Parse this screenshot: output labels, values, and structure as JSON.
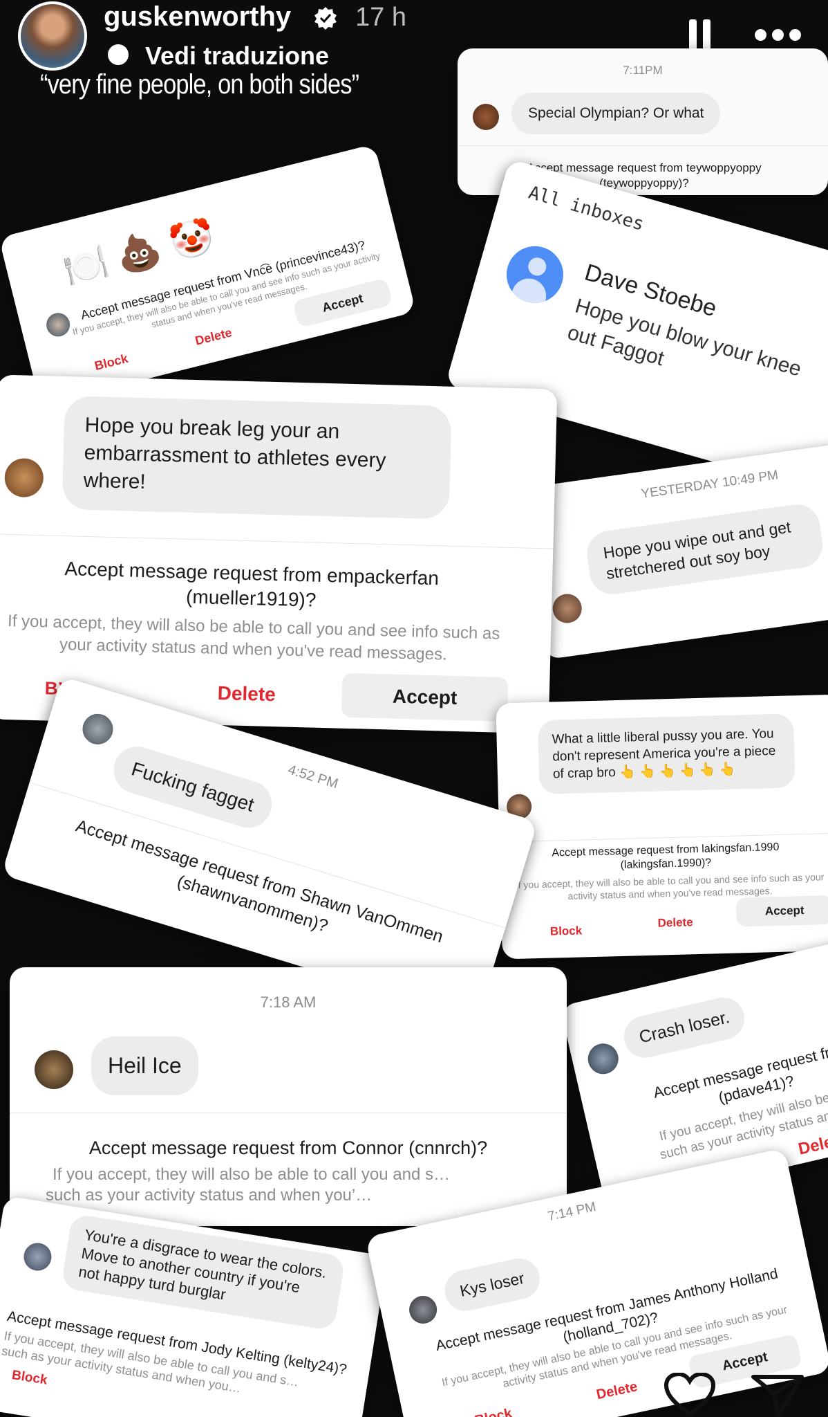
{
  "story": {
    "username": "guskenworthy",
    "time_ago": "17 h",
    "translate_label": "Vedi traduzione",
    "caption": "“very fine people, on both sides”"
  },
  "cards": {
    "teywoppy": {
      "time": "7:11PM",
      "message": "Special Olympian? Or what",
      "request": "Accept message request from teywoppyoppy (teywoppyoppy)?"
    },
    "vince": {
      "emojis": "🍽️ 💩 🤡",
      "request": "Accept message request from Vnc͡e (princevince43)?",
      "info": "If you accept, they will also be able to call you and see info such as your activity status and when you've read messages.",
      "accept": "Accept",
      "delete": "Delete",
      "block": "Block"
    },
    "dave": {
      "header": "All inboxes",
      "name": "Dave Stoebe",
      "message": "Hope you blow your knee out Faggot"
    },
    "mueller": {
      "message": "Hope you break leg your an embarrassment to athletes every where!",
      "request_line1": "Accept message request from empackerfan",
      "request_line2": "(mueller1919)?",
      "info": "If you accept, they will also be able to call you and see info such as your activity status and when you've read messages.",
      "block": "Bʼ",
      "delete": "Delete",
      "accept": "Accept"
    },
    "soyboy": {
      "time": "YESTERDAY 10:49 PM",
      "message": "Hope you wipe out and get stretchered out soy boy"
    },
    "shawn": {
      "time": "4:52 PM",
      "message": "Fucking fagget",
      "request_line1": "Accept message request from Shawn VanOmmen",
      "request_line2": "(shawnvanommen)?"
    },
    "lakings": {
      "message": "What a little liberal pussy you are. You don't represent America you're a piece of crap bro 👆 👆 👆 👆 👆 👆",
      "request_line1": "Accept message request from lakingsfan.1990",
      "request_line2": "(lakingsfan.1990)?",
      "info": "If you accept, they will also be able to call you and see info such as your activity status and when you've read messages.",
      "block": "Block",
      "delete": "Delete",
      "accept": "Accept"
    },
    "connor": {
      "time": "7:18 AM",
      "message": "Heil Ice",
      "request": "Accept message request from Connor (cnnrch)?",
      "info_line1": "If you accept, they will also be able to call you and s…",
      "info_line2": "such as your activity status and when you’…"
    },
    "pdave": {
      "message": "Crash loser.",
      "request_line1": "Accept message request from",
      "request_line2": "(pdave41)?",
      "info_line1": "If you accept, they will also be able",
      "info_line2": "such as your activity status and whe",
      "delete": "Delete"
    },
    "kelty": {
      "message": "You're a disgrace to wear the colors. Move to another country if you're not happy turd burglar",
      "request": "Accept message request from Jody Kelting (kelty24)?",
      "info_line1": "If you accept, they will also be able to call you and s…",
      "info_line2": "such as your activity status and when you…",
      "block": "Block"
    },
    "holland": {
      "time": "7:14 PM",
      "message": "Kys loser",
      "request_line1": "Accept message request from James Anthony Holland",
      "request_line2": "(holland_702)?",
      "info": "If you accept, they will also be able to call you and see info such as your activity status and when you've read messages.",
      "block": "Block",
      "delete": "Delete",
      "accept": "Accept"
    }
  },
  "colors": {
    "background": "#0c0c0c",
    "danger": "#e0282e",
    "bubble": "#ececec",
    "google_blue": "#4f8ef7"
  },
  "icons": [
    "verified-badge-icon",
    "pause-icon",
    "more-icon",
    "translate-icon",
    "heart-icon",
    "share-icon",
    "profile-placeholder-icon"
  ]
}
